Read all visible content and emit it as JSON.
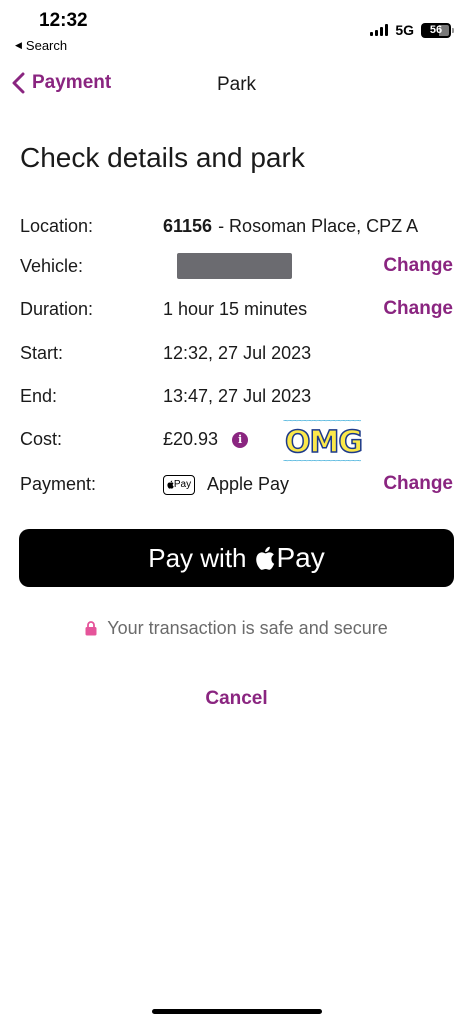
{
  "status": {
    "time": "12:32",
    "back_app": "Search",
    "network": "5G",
    "battery": "56"
  },
  "nav": {
    "back_label": "Payment",
    "title": "Park"
  },
  "heading": "Check details and park",
  "details": {
    "location": {
      "label": "Location:",
      "code": "61156",
      "name": "- Rosoman Place, CPZ A"
    },
    "vehicle": {
      "label": "Vehicle:",
      "change": "Change"
    },
    "duration": {
      "label": "Duration:",
      "value": "1 hour 15 minutes",
      "change": "Change"
    },
    "start": {
      "label": "Start:",
      "value": "12:32, 27 Jul 2023"
    },
    "end": {
      "label": "End:",
      "value": "13:47, 27 Jul 2023"
    },
    "cost": {
      "label": "Cost:",
      "value": "£20.93",
      "info": "i"
    },
    "payment": {
      "label": "Payment:",
      "badge": "Pay",
      "value": "Apple Pay",
      "change": "Change"
    }
  },
  "sticker": {
    "text": "OMG"
  },
  "pay_button": {
    "prefix": "Pay with",
    "suffix": "Pay"
  },
  "secure_text": "Your transaction is safe and secure",
  "cancel_label": "Cancel",
  "colors": {
    "accent": "#8a2580",
    "plate": "#6b6b70",
    "button": "#000000"
  }
}
